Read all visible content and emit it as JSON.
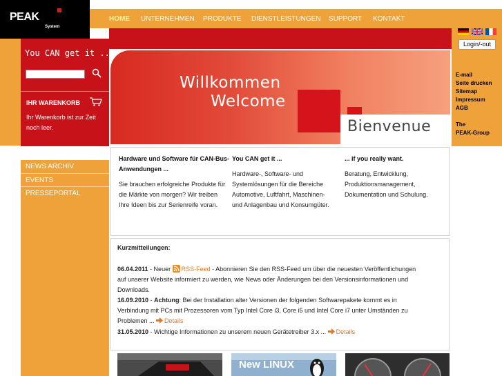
{
  "brand": {
    "name": "PEAK",
    "subtitle": "System"
  },
  "topnav": [
    "HOME",
    "UNTERNEHMEN",
    "PRODUKTE",
    "DIENSTLEISTUNGEN",
    "SUPPORT",
    "KONTAKT"
  ],
  "sidebar": {
    "slogan": "You CAN get it ...",
    "search": {
      "value": "",
      "placeholder": ""
    },
    "cart_title": "IHR WARENKORB",
    "cart_text": "Ihr Warenkorb ist zur Zeit noch leer.",
    "nav": [
      "NEWS ARCHIV",
      "EVENTS",
      "PRESSEPORTAL"
    ]
  },
  "banner": {
    "line1": "Willkommen",
    "line2": "Welcome",
    "line3": "Bienvenue"
  },
  "header_right": {
    "login": "Login/-out",
    "links": [
      "E-mail",
      "Seite drucken",
      "Sitemap",
      "Impressum",
      "AGB",
      "The",
      "PEAK-Group"
    ]
  },
  "intro": [
    {
      "title": "Hardware und Software für CAN-Bus-Anwendungen ...",
      "body": "Sie brauchen erfolgreiche Produkte für die Märkte von morgen? Wir treiben Ihre Ideen bis zur Serienreife voran."
    },
    {
      "title": "You CAN get it ...",
      "body": "Hardware-, Software- und Systemlösungen für die Bereiche Automotive, Luftfahrt, Maschinen- und Anlagenbau und Konsumgüter."
    },
    {
      "title": "... if you really want.",
      "body": "Beratung, Entwicklung, Produktionsmanagement, Dokumentation und Schulung."
    }
  ],
  "news": {
    "title": "Kurzmitteilungen:",
    "lines": {
      "l1_date": "06.04.2011",
      "l1_pre": " - Neuer ",
      "l1_link": "RSS-Feed",
      "l1_post": " - Abonnieren Sie den RSS-Feed um über die neuesten Veröffentlichungen",
      "l2": "auf unserer Website informiert zu werden, wie News oder Änderungen bei den Versionsinformationen und",
      "l3": "Downloads.",
      "l4_date": "16.09.2010",
      "l4_sep": " - ",
      "l4_bold": "Achtung",
      "l4_post": ": Bei der Installation alter Versionen der folgenden Softwarepakete kommt es in",
      "l5": "Verbindung mit PCs mit Prozessoren vom Typ Intel Core i3, Core i5 und Intel Core i7 unter Umständen zu",
      "l6": "Problemen ... ",
      "l6_link": "Details",
      "l7_date": "31.05.2010",
      "l7_post": " - Wichtige Informationen zu unserem neuen Gerätetreiber 3.x ... ",
      "l7_link": "Details"
    }
  },
  "thumbs": {
    "linux": "New LINUX"
  },
  "colors": {
    "orange": "#f0a23a",
    "red": "#c8121a",
    "link_orange": "#e07828",
    "black": "#000000"
  }
}
